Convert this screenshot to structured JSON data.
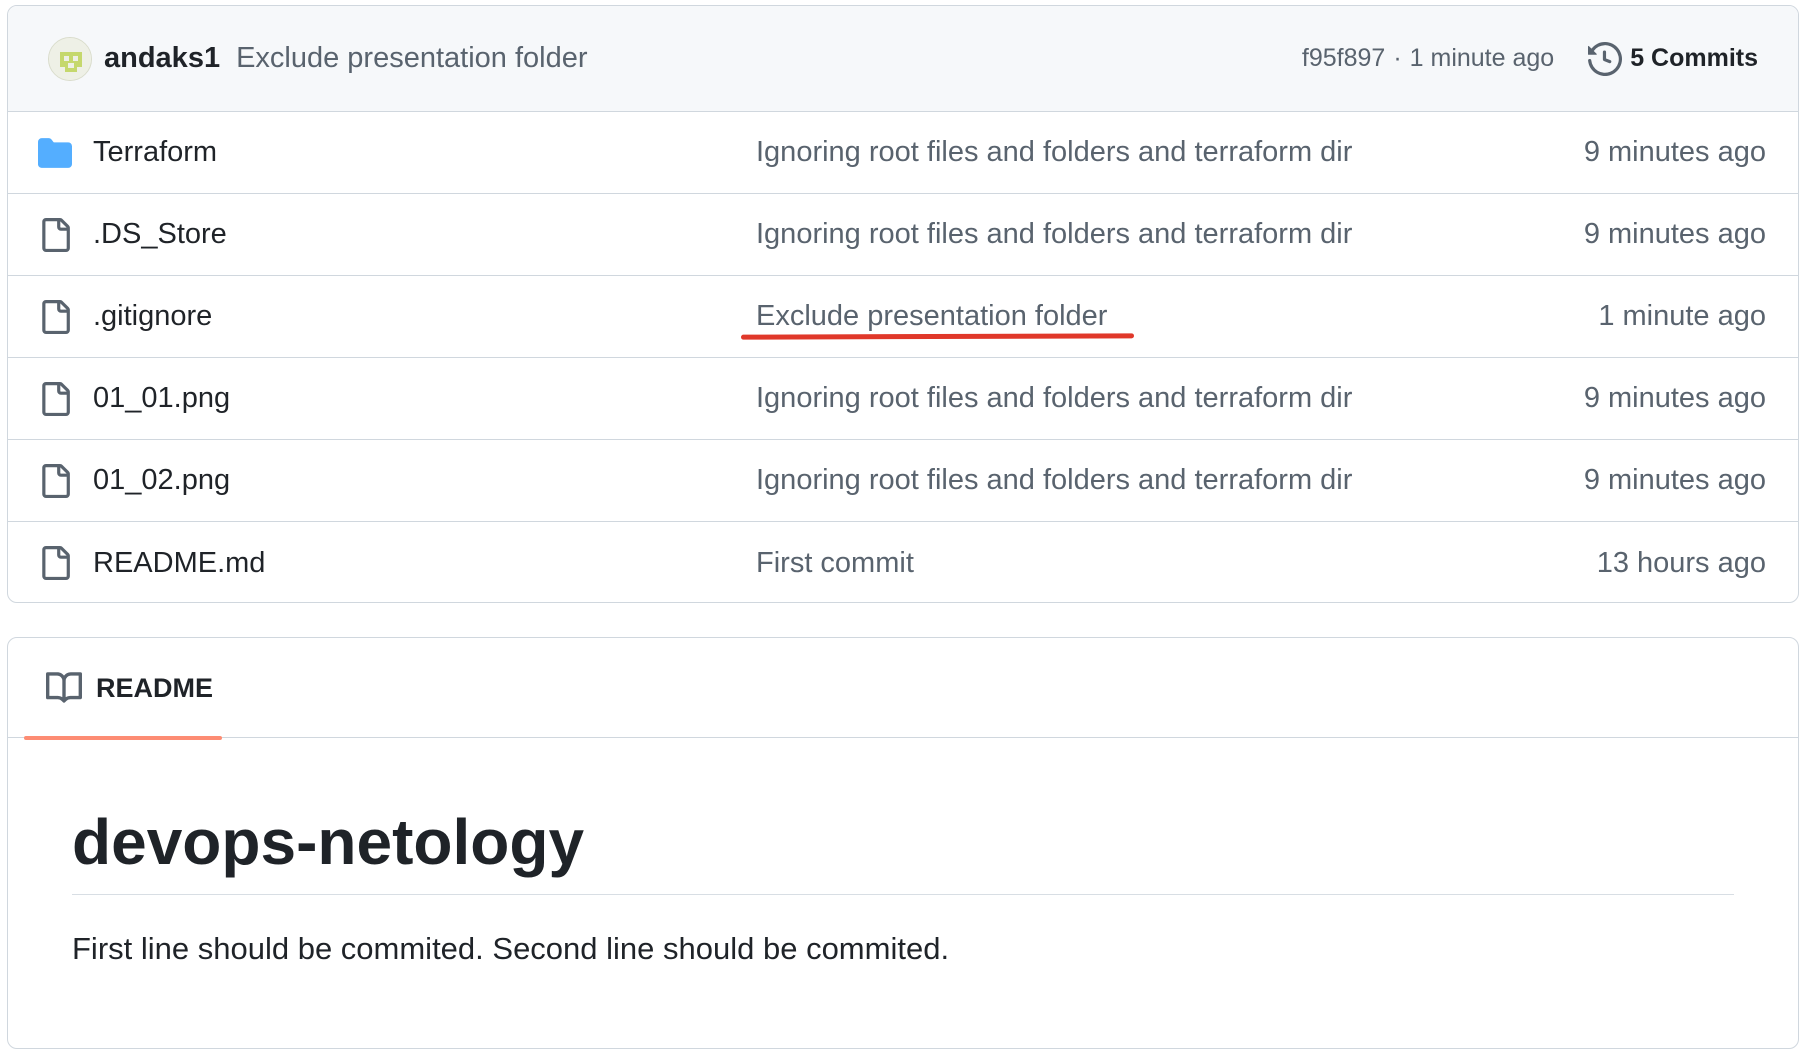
{
  "latest_commit": {
    "author": "andaks1",
    "message": "Exclude presentation folder",
    "sha": "f95f897",
    "separator": "·",
    "time": "1 minute ago",
    "commits_label": "5 Commits",
    "avatar_icon": "identicon-avatar",
    "history_icon": "history-icon"
  },
  "files": [
    {
      "type": "folder",
      "icon": "folder-icon",
      "name": "Terraform",
      "commit_message": "Ignoring root files and folders and terraform dir",
      "age": "9 minutes ago"
    },
    {
      "type": "file",
      "icon": "file-icon",
      "name": ".DS_Store",
      "commit_message": "Ignoring root files and folders and terraform dir",
      "age": "9 minutes ago"
    },
    {
      "type": "file",
      "icon": "file-icon",
      "name": ".gitignore",
      "commit_message": "Exclude presentation folder",
      "age": "1 minute ago"
    },
    {
      "type": "file",
      "icon": "file-icon",
      "name": "01_01.png",
      "commit_message": "Ignoring root files and folders and terraform dir",
      "age": "9 minutes ago"
    },
    {
      "type": "file",
      "icon": "file-icon",
      "name": "01_02.png",
      "commit_message": "Ignoring root files and folders and terraform dir",
      "age": "9 minutes ago"
    },
    {
      "type": "file",
      "icon": "file-icon",
      "name": "README.md",
      "commit_message": "First commit",
      "age": "13 hours ago"
    }
  ],
  "readme": {
    "tab_label": "README",
    "tab_icon": "book-icon",
    "title": "devops-netology",
    "paragraph": "First line should be commited. Second line should be commited."
  },
  "colors": {
    "folder": "#54aeff",
    "annotation_underline": "#e0382a",
    "tab_underline": "#fd8c73",
    "muted_text": "#59636e",
    "border": "#d0d7de",
    "header_bg": "#f6f8fa"
  }
}
